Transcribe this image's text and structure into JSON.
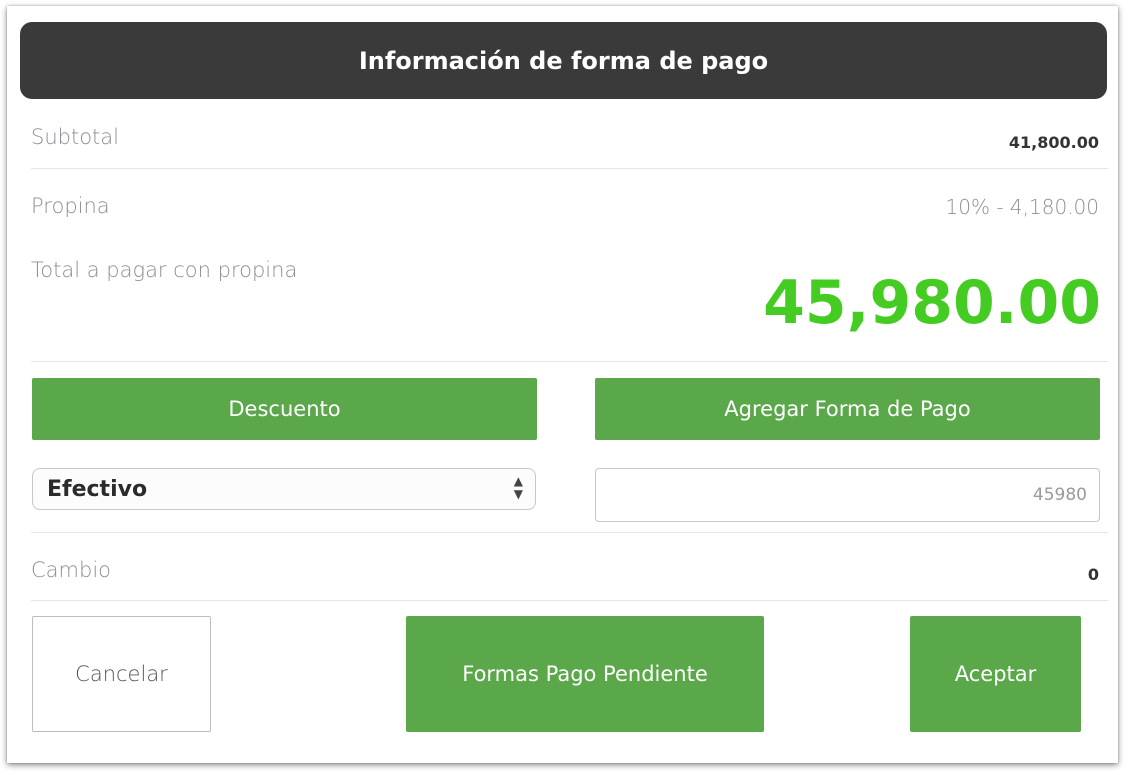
{
  "header": {
    "title": "Información de forma de pago"
  },
  "summary": {
    "subtotal_label": "Subtotal",
    "subtotal_value": "41,800.00",
    "tip_label": "Propina",
    "tip_value": "10% - 4,180.00",
    "total_label": "Total a pagar con propina",
    "total_value": "45,980.00"
  },
  "actions": {
    "discount_label": "Descuento",
    "add_payment_label": "Agregar Forma de Pago"
  },
  "payment": {
    "method_selected": "Efectivo",
    "amount_value": "45980"
  },
  "change": {
    "label": "Cambio",
    "value": "0"
  },
  "footer": {
    "cancel_label": "Cancelar",
    "pending_label": "Formas Pago Pendiente",
    "accept_label": "Aceptar"
  },
  "colors": {
    "header_bg": "#3a3a3a",
    "accent_green": "#5aa84a",
    "total_green": "#44cc22",
    "muted_text": "#8a8f98"
  }
}
